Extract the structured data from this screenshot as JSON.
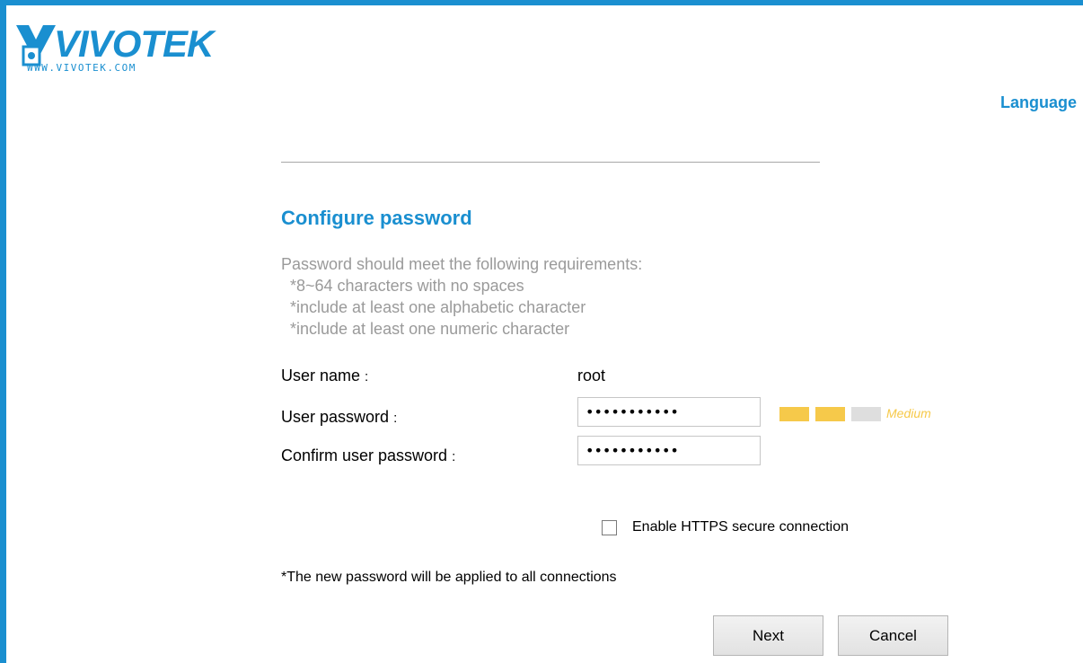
{
  "brand": {
    "name": "VIVOTEK",
    "url": "WWW.VIVOTEK.COM",
    "color": "#1a8fd0"
  },
  "header": {
    "language_label": "Language"
  },
  "form": {
    "title": "Configure password",
    "requirements_intro": "Password should meet the following requirements:",
    "requirements": [
      "*8~64 characters with no spaces",
      "*include at least one alphabetic character",
      "*include at least one numeric character"
    ],
    "username_label": "User name",
    "username_value": "root",
    "password_label": "User password",
    "password_value": "•••••••••••",
    "confirm_label": "Confirm user password",
    "confirm_value": "•••••••••••",
    "label_separator": ":",
    "strength": {
      "label": "Medium",
      "level": 2,
      "max_level": 3,
      "active_color": "#f6c94a",
      "inactive_color": "#dedede"
    },
    "https_label": "Enable HTTPS secure connection",
    "https_checked": false,
    "note": "*The new password will be applied to all connections",
    "next_label": "Next",
    "cancel_label": "Cancel"
  }
}
